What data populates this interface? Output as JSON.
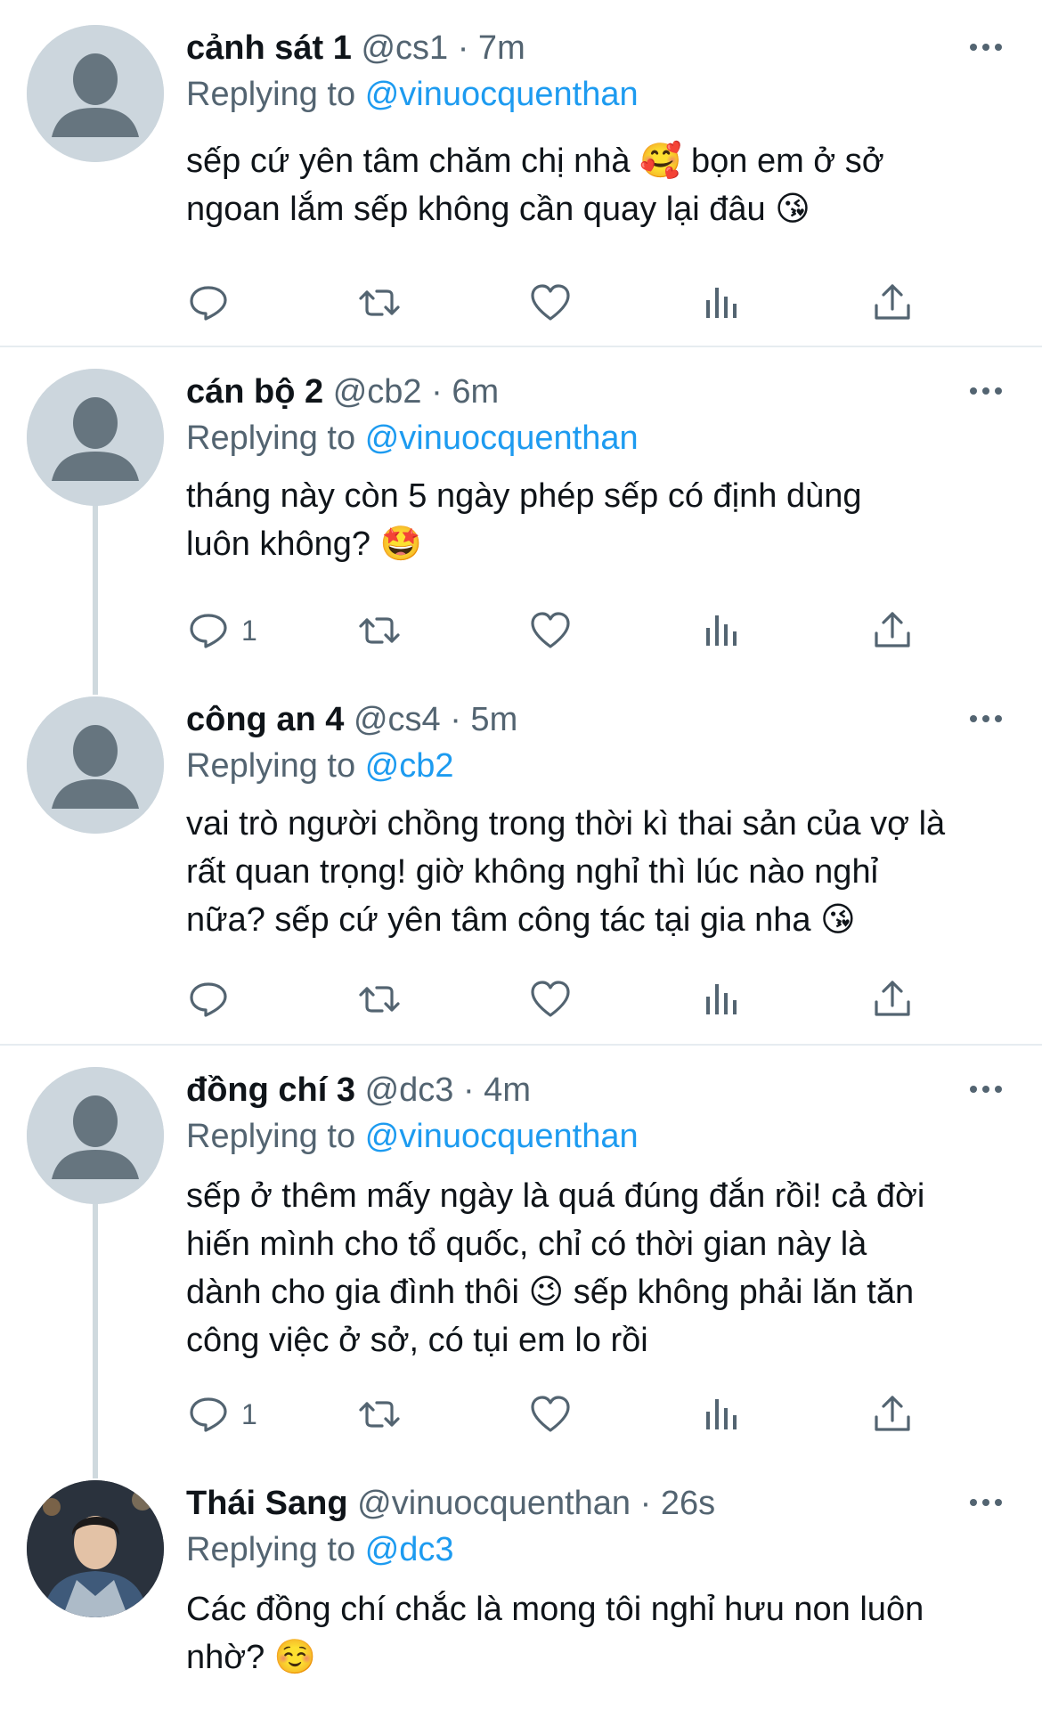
{
  "icons": {
    "more": "more-dots-icon",
    "reply": "reply-icon",
    "retweet": "retweet-icon",
    "like": "like-icon",
    "analytics": "analytics-icon",
    "share": "share-icon"
  },
  "colors": {
    "link": "#1d9bf0",
    "secondary": "#536471",
    "avatar_placeholder": "#ccd6dd"
  },
  "tweets": [
    {
      "name": "cảnh sát 1",
      "handle": "@cs1",
      "time": "· 7m",
      "replying_prefix": "Replying to",
      "replying_to": "@vinuocquenthan",
      "text": "sếp cứ yên tâm chăm chị nhà 🥰 bọn em ở sở\nngoan lắm sếp không cần quay lại đâu 😘",
      "reply_count": ""
    },
    {
      "name": "cán bộ 2",
      "handle": "@cb2",
      "time": "· 6m",
      "replying_prefix": "Replying to",
      "replying_to": "@vinuocquenthan",
      "text": "tháng này còn 5 ngày phép sếp có định dùng\nluôn không? 🤩",
      "reply_count": "1"
    },
    {
      "name": "công an 4",
      "handle": "@cs4",
      "time": "· 5m",
      "replying_prefix": "Replying to",
      "replying_to": "@cb2",
      "text": "vai trò người chồng trong thời kì thai sản của vợ là\nrất quan trọng! giờ không nghỉ thì lúc nào nghỉ\nnữa? sếp cứ yên tâm công tác tại gia nha 😘",
      "reply_count": ""
    },
    {
      "name": "đồng chí 3",
      "handle": "@dc3",
      "time": "· 4m",
      "replying_prefix": "Replying to",
      "replying_to": "@vinuocquenthan",
      "text": "sếp ở thêm mấy ngày là quá đúng đắn rồi! cả đời\nhiến mình cho tổ quốc, chỉ có thời gian này là\ndành cho gia đình thôi 😉 sếp không phải lăn tăn\ncông việc ở sở, có tụi em lo rồi",
      "reply_count": "1"
    },
    {
      "name": "Thái Sang",
      "handle": "@vinuocquenthan",
      "time": "· 26s",
      "replying_prefix": "Replying to",
      "replying_to": "@dc3",
      "text": "Các đồng chí chắc là mong tôi nghỉ hưu non luôn\nnhờ? ☺️",
      "reply_count": ""
    }
  ]
}
